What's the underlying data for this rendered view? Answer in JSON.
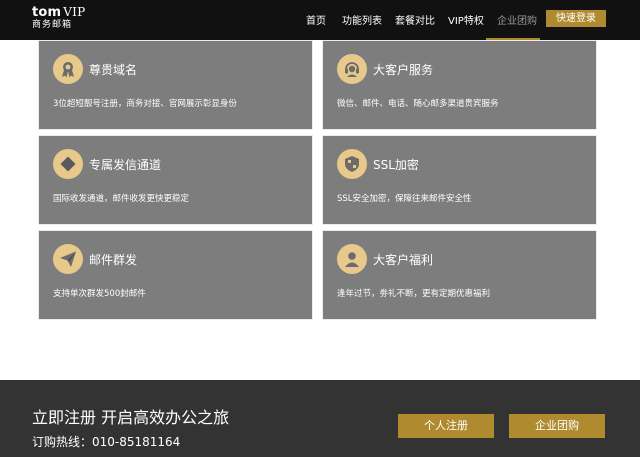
{
  "header": {
    "logo_main": "tom",
    "logo_vip": "VIP",
    "logo_sub": "商务邮箱",
    "nav": [
      {
        "label": "首页"
      },
      {
        "label": "功能列表"
      },
      {
        "label": "套餐对比"
      },
      {
        "label": "VIP特权"
      },
      {
        "label": "企业团购"
      }
    ],
    "active_nav": "企业团购",
    "login_label": "快速登录"
  },
  "features": [
    {
      "icon": "ribbon-badge-icon",
      "title": "尊贵域名",
      "desc": "3位超短靓号注册，商务对接、官网展示彰显身份"
    },
    {
      "icon": "customer-service-headset-icon",
      "title": "大客户服务",
      "desc": "微信、邮件、电话、随心邮多渠道贵宾服务"
    },
    {
      "icon": "diamond-icon",
      "title": "专属发信通道",
      "desc": "国际收发通道，邮件收发更快更稳定"
    },
    {
      "icon": "shield-icon",
      "title": "SSL加密",
      "desc": "SSL安全加密，保障往来邮件安全性"
    },
    {
      "icon": "paper-plane-icon",
      "title": "邮件群发",
      "desc": "支持单次群发500封邮件"
    },
    {
      "icon": "user-icon",
      "title": "大客户福利",
      "desc": "逢年过节，劵礼不断，更有定期优惠福利"
    }
  ],
  "footer": {
    "title": "立即注册 开启高效办公之旅",
    "hotline": "订购热线：010-85181164",
    "personal_register_label": "个人注册",
    "enterprise_label": "企业团购"
  },
  "colors": {
    "header_bg": "#111111",
    "accent_gold": "#b08a2e",
    "card_bg": "#7d7d7d",
    "icon_bg": "#e6c98b",
    "footer_bg": "#333333"
  }
}
